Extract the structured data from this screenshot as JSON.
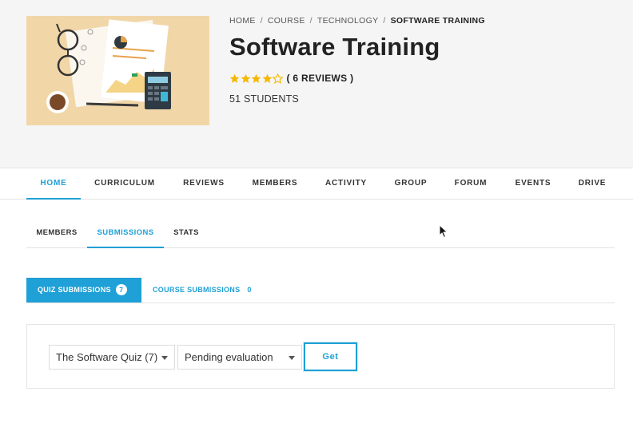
{
  "breadcrumb": {
    "items": [
      "HOME",
      "COURSE",
      "TECHNOLOGY"
    ],
    "current": "SOFTWARE TRAINING",
    "separator": "/"
  },
  "course": {
    "title": "Software Training",
    "rating": 4,
    "rating_max": 5,
    "reviews_label": "( 6 REVIEWS )",
    "students_label": "51 STUDENTS"
  },
  "nav": {
    "items": [
      "HOME",
      "CURRICULUM",
      "REVIEWS",
      "MEMBERS",
      "ACTIVITY",
      "GROUP",
      "FORUM",
      "EVENTS",
      "DRIVE"
    ],
    "active": "HOME"
  },
  "subtabs": {
    "items": [
      "MEMBERS",
      "SUBMISSIONS",
      "STATS"
    ],
    "active": "SUBMISSIONS"
  },
  "submission_tabs": {
    "quiz_label": "QUIZ SUBMISSIONS",
    "quiz_count": "7",
    "course_label": "COURSE SUBMISSIONS",
    "course_count": "0"
  },
  "filters": {
    "quiz_select_value": "The Software Quiz (7)",
    "status_select_value": "Pending evaluation",
    "get_label": "Get"
  },
  "colors": {
    "accent": "#1fa0d6",
    "star": "#f5b800",
    "hero_bg": "#f5f5f5"
  },
  "icons": {
    "star": "star-icon",
    "caret": "chevron-down-icon",
    "cursor": "mouse-pointer-icon"
  }
}
